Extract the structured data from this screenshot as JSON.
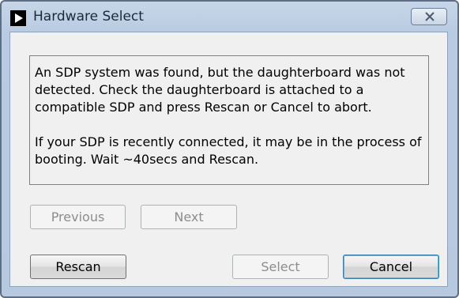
{
  "window": {
    "title": "Hardware Select",
    "icon": "play-triangle-icon",
    "close_icon": "close-x-icon"
  },
  "message": {
    "paragraph_1": "An SDP system was found, but the daughterboard was not detected. Check the daughterboard is attached to a compatible SDP and press Rescan or Cancel to abort.",
    "paragraph_2": "If your SDP is recently connected, it may be in the process of booting. Wait ~40secs and Rescan."
  },
  "buttons": {
    "previous": {
      "label": "Previous",
      "enabled": false
    },
    "next": {
      "label": "Next",
      "enabled": false
    },
    "rescan": {
      "label": "Rescan",
      "enabled": true
    },
    "select": {
      "label": "Select",
      "enabled": false
    },
    "cancel": {
      "label": "Cancel",
      "enabled": true,
      "default": true
    }
  },
  "colors": {
    "frame": "#b9cbe2",
    "client_background": "#f0f0f0",
    "disabled_text": "#8d8d8d",
    "default_button_glow": "#48b8e6"
  }
}
